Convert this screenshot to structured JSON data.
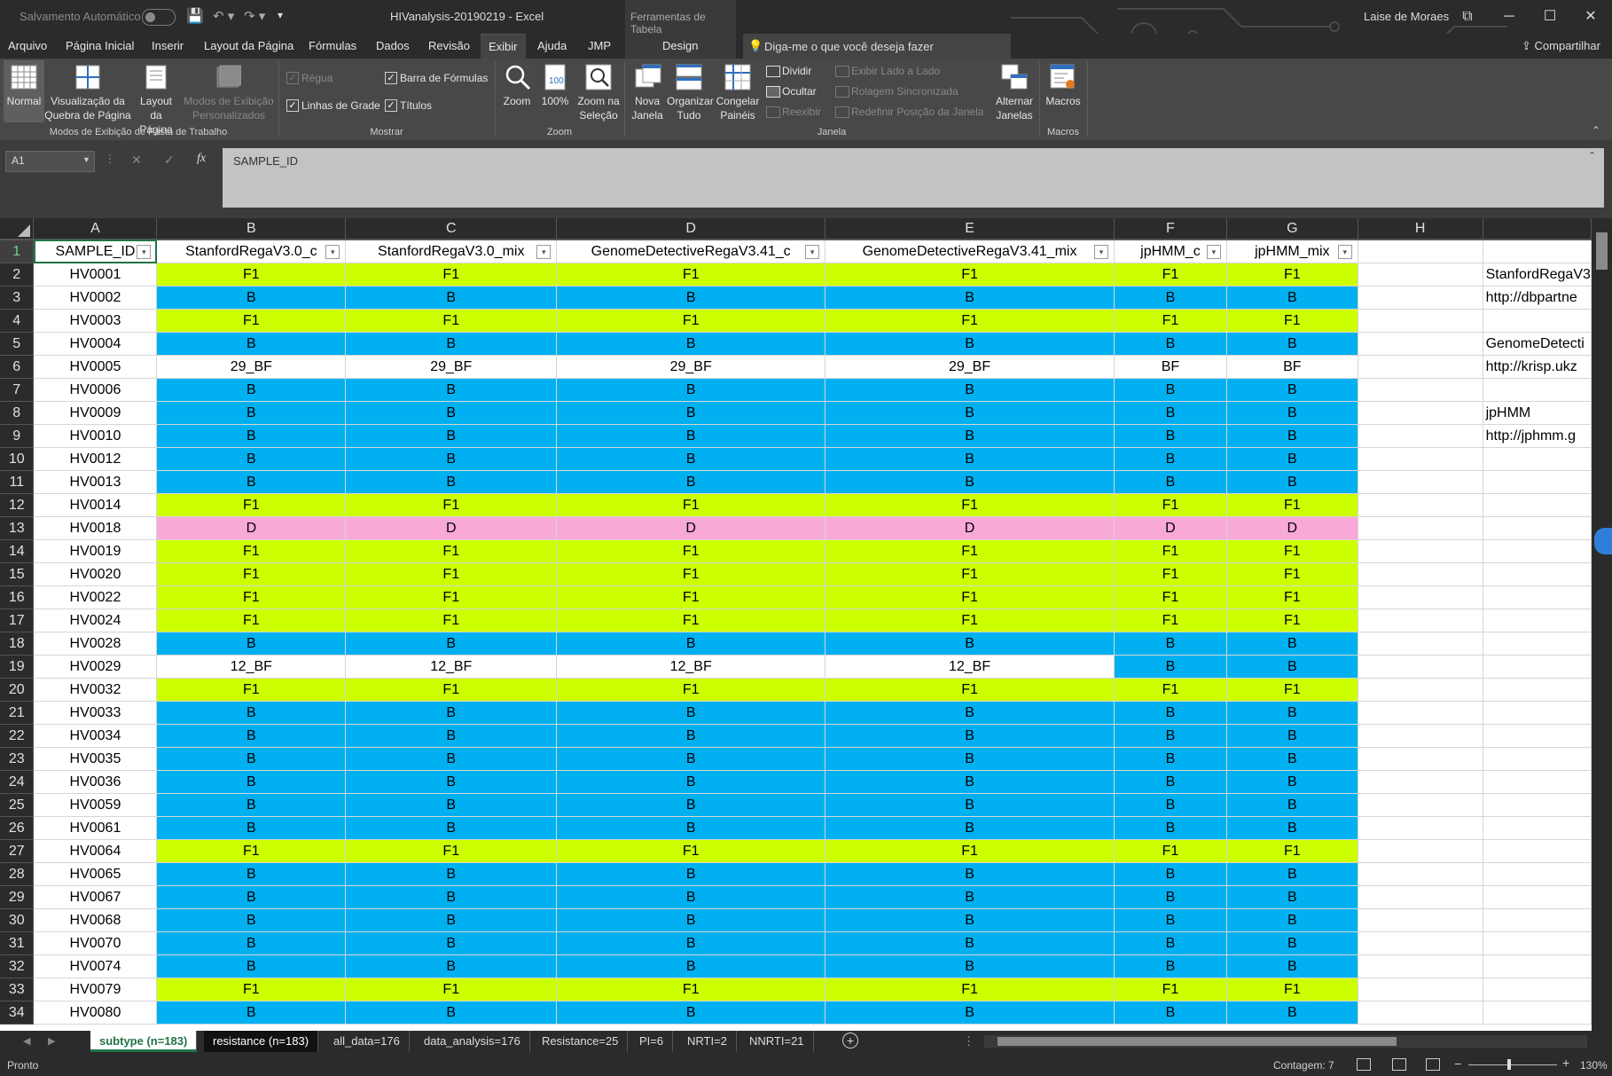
{
  "titlebar": {
    "autosave_label": "Salvamento Automático",
    "file_title": "HIVanalysis-20190219  -  Excel",
    "tools_context": "Ferramentas de Tabela",
    "user": "Laise de Moraes",
    "restore_glyph": "⧉",
    "minimize_glyph": "─",
    "maximize_glyph": "☐",
    "close_glyph": "✕"
  },
  "menu": {
    "items": [
      "Arquivo",
      "Página Inicial",
      "Inserir",
      "Layout da Página",
      "Fórmulas",
      "Dados",
      "Revisão",
      "Exibir",
      "Ajuda",
      "JMP"
    ],
    "design": "Design",
    "search_placeholder": "Diga-me o que você deseja fazer",
    "share": "Compartilhar"
  },
  "ribbon": {
    "modes": {
      "normal": "Normal",
      "page_break_1": "Visualização da",
      "page_break_2": "Quebra de Página",
      "page_layout_1": "Layout",
      "page_layout_2": "da Página",
      "custom_1": "Modos de Exibição",
      "custom_2": "Personalizados",
      "group": "Modos de Exibição de Pasta de Trabalho"
    },
    "show": {
      "ruler": "Régua",
      "formula_bar": "Barra de Fórmulas",
      "gridlines": "Linhas de Grade",
      "headings": "Títulos",
      "group": "Mostrar"
    },
    "zoom": {
      "zoom": "Zoom",
      "hundred": "100%",
      "zoom_sel_1": "Zoom na",
      "zoom_sel_2": "Seleção",
      "group": "Zoom"
    },
    "window": {
      "new_1": "Nova",
      "new_2": "Janela",
      "arrange_1": "Organizar",
      "arrange_2": "Tudo",
      "freeze_1": "Congelar",
      "freeze_2": "Painéis",
      "split": "Dividir",
      "hide": "Ocultar",
      "unhide": "Reexibir",
      "side_by_side": "Exibir Lado a Lado",
      "sync_scroll": "Rolagem Sincronizada",
      "reset_pos": "Redefinir Posição da Janela",
      "switch_1": "Alternar",
      "switch_2": "Janelas",
      "group": "Janela"
    },
    "macros": {
      "macros": "Macros",
      "group": "Macros"
    }
  },
  "formula_bar": {
    "name_box": "A1",
    "fx": "fx",
    "cancel": "✕",
    "enter": "✓",
    "content": "SAMPLE_ID"
  },
  "columns": [
    "A",
    "B",
    "C",
    "D",
    "E",
    "F",
    "G",
    "H"
  ],
  "headers": [
    "SAMPLE_ID",
    "StanfordRegaV3.0_c",
    "StanfordRegaV3.0_mix",
    "GenomeDetectiveRegaV3.41_c",
    "GenomeDetectiveRegaV3.41_mix",
    "jpHMM_c",
    "jpHMM_mix"
  ],
  "rows": [
    {
      "n": "2",
      "id": "HV0001",
      "v": [
        "F1",
        "F1",
        "F1",
        "F1",
        "F1",
        "F1"
      ]
    },
    {
      "n": "3",
      "id": "HV0002",
      "v": [
        "B",
        "B",
        "B",
        "B",
        "B",
        "B"
      ]
    },
    {
      "n": "4",
      "id": "HV0003",
      "v": [
        "F1",
        "F1",
        "F1",
        "F1",
        "F1",
        "F1"
      ]
    },
    {
      "n": "5",
      "id": "HV0004",
      "v": [
        "B",
        "B",
        "B",
        "B",
        "B",
        "B"
      ]
    },
    {
      "n": "6",
      "id": "HV0005",
      "v": [
        "29_BF",
        "29_BF",
        "29_BF",
        "29_BF",
        "BF",
        "BF"
      ]
    },
    {
      "n": "7",
      "id": "HV0006",
      "v": [
        "B",
        "B",
        "B",
        "B",
        "B",
        "B"
      ]
    },
    {
      "n": "8",
      "id": "HV0009",
      "v": [
        "B",
        "B",
        "B",
        "B",
        "B",
        "B"
      ]
    },
    {
      "n": "9",
      "id": "HV0010",
      "v": [
        "B",
        "B",
        "B",
        "B",
        "B",
        "B"
      ]
    },
    {
      "n": "10",
      "id": "HV0012",
      "v": [
        "B",
        "B",
        "B",
        "B",
        "B",
        "B"
      ]
    },
    {
      "n": "11",
      "id": "HV0013",
      "v": [
        "B",
        "B",
        "B",
        "B",
        "B",
        "B"
      ]
    },
    {
      "n": "12",
      "id": "HV0014",
      "v": [
        "F1",
        "F1",
        "F1",
        "F1",
        "F1",
        "F1"
      ]
    },
    {
      "n": "13",
      "id": "HV0018",
      "v": [
        "D",
        "D",
        "D",
        "D",
        "D",
        "D"
      ]
    },
    {
      "n": "14",
      "id": "HV0019",
      "v": [
        "F1",
        "F1",
        "F1",
        "F1",
        "F1",
        "F1"
      ]
    },
    {
      "n": "15",
      "id": "HV0020",
      "v": [
        "F1",
        "F1",
        "F1",
        "F1",
        "F1",
        "F1"
      ]
    },
    {
      "n": "16",
      "id": "HV0022",
      "v": [
        "F1",
        "F1",
        "F1",
        "F1",
        "F1",
        "F1"
      ]
    },
    {
      "n": "17",
      "id": "HV0024",
      "v": [
        "F1",
        "F1",
        "F1",
        "F1",
        "F1",
        "F1"
      ]
    },
    {
      "n": "18",
      "id": "HV0028",
      "v": [
        "B",
        "B",
        "B",
        "B",
        "B",
        "B"
      ]
    },
    {
      "n": "19",
      "id": "HV0029",
      "v": [
        "12_BF",
        "12_BF",
        "12_BF",
        "12_BF",
        "B",
        "B"
      ]
    },
    {
      "n": "20",
      "id": "HV0032",
      "v": [
        "F1",
        "F1",
        "F1",
        "F1",
        "F1",
        "F1"
      ]
    },
    {
      "n": "21",
      "id": "HV0033",
      "v": [
        "B",
        "B",
        "B",
        "B",
        "B",
        "B"
      ]
    },
    {
      "n": "22",
      "id": "HV0034",
      "v": [
        "B",
        "B",
        "B",
        "B",
        "B",
        "B"
      ]
    },
    {
      "n": "23",
      "id": "HV0035",
      "v": [
        "B",
        "B",
        "B",
        "B",
        "B",
        "B"
      ]
    },
    {
      "n": "24",
      "id": "HV0036",
      "v": [
        "B",
        "B",
        "B",
        "B",
        "B",
        "B"
      ]
    },
    {
      "n": "25",
      "id": "HV0059",
      "v": [
        "B",
        "B",
        "B",
        "B",
        "B",
        "B"
      ]
    },
    {
      "n": "26",
      "id": "HV0061",
      "v": [
        "B",
        "B",
        "B",
        "B",
        "B",
        "B"
      ]
    },
    {
      "n": "27",
      "id": "HV0064",
      "v": [
        "F1",
        "F1",
        "F1",
        "F1",
        "F1",
        "F1"
      ]
    },
    {
      "n": "28",
      "id": "HV0065",
      "v": [
        "B",
        "B",
        "B",
        "B",
        "B",
        "B"
      ]
    },
    {
      "n": "29",
      "id": "HV0067",
      "v": [
        "B",
        "B",
        "B",
        "B",
        "B",
        "B"
      ]
    },
    {
      "n": "30",
      "id": "HV0068",
      "v": [
        "B",
        "B",
        "B",
        "B",
        "B",
        "B"
      ]
    },
    {
      "n": "31",
      "id": "HV0070",
      "v": [
        "B",
        "B",
        "B",
        "B",
        "B",
        "B"
      ]
    },
    {
      "n": "32",
      "id": "HV0074",
      "v": [
        "B",
        "B",
        "B",
        "B",
        "B",
        "B"
      ]
    },
    {
      "n": "33",
      "id": "HV0079",
      "v": [
        "F1",
        "F1",
        "F1",
        "F1",
        "F1",
        "F1"
      ]
    },
    {
      "n": "34",
      "id": "HV0080",
      "v": [
        "B",
        "B",
        "B",
        "B",
        "B",
        "B"
      ]
    }
  ],
  "side_notes": {
    "2": "StanfordRegaV3",
    "3": "http://dbpartne",
    "5": "GenomeDetecti",
    "6": "http://krisp.ukz",
    "8": "jpHMM",
    "9": "http://jphmm.g"
  },
  "subtype_colors": {
    "F1": "#ccff00",
    "B": "#00b0f0",
    "D": "#f9a9d7",
    "mixed": "#ffffff"
  },
  "sheets": [
    "subtype (n=183)",
    "resistance (n=183)",
    "all_data=176",
    "data_analysis=176",
    "Resistance=25",
    "PI=6",
    "NRTI=2",
    "NNRTI=21"
  ],
  "status": {
    "ready": "Pronto",
    "count": "Contagem: 7",
    "zoom": "130%"
  }
}
